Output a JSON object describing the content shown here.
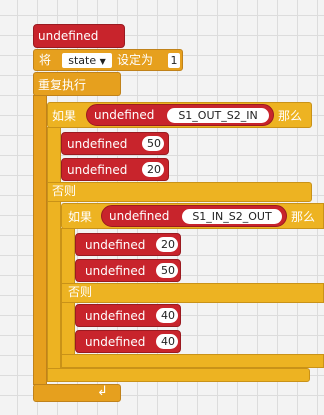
{
  "hat_label": "undefined",
  "set_block": {
    "prefix": "将",
    "var_name": "state",
    "dropdown_arrow": "▼",
    "suffix": "设定为",
    "value": "1"
  },
  "repeat_label": "重复执行",
  "if1": {
    "if_label": "如果",
    "cond_label": "undefined",
    "cond_value": "S1_OUT_S2_IN",
    "then_label": "那么",
    "then_blocks": [
      {
        "label": "undefined",
        "value": "50"
      },
      {
        "label": "undefined",
        "value": "20"
      }
    ],
    "else_label": "否则"
  },
  "if2": {
    "if_label": "如果",
    "cond_label": "undefined",
    "cond_value": "S1_IN_S2_OUT",
    "then_label": "那么",
    "then_blocks": [
      {
        "label": "undefined",
        "value": "20"
      },
      {
        "label": "undefined",
        "value": "50"
      }
    ],
    "else_label": "否则",
    "else_blocks": [
      {
        "label": "undefined",
        "value": "40"
      },
      {
        "label": "undefined",
        "value": "40"
      }
    ]
  },
  "loop_arrow": "↲",
  "colors": {
    "red": "#c8242c",
    "orange": "#e6a01e",
    "yellow": "#edb322",
    "grid": "#dcdcdc"
  }
}
